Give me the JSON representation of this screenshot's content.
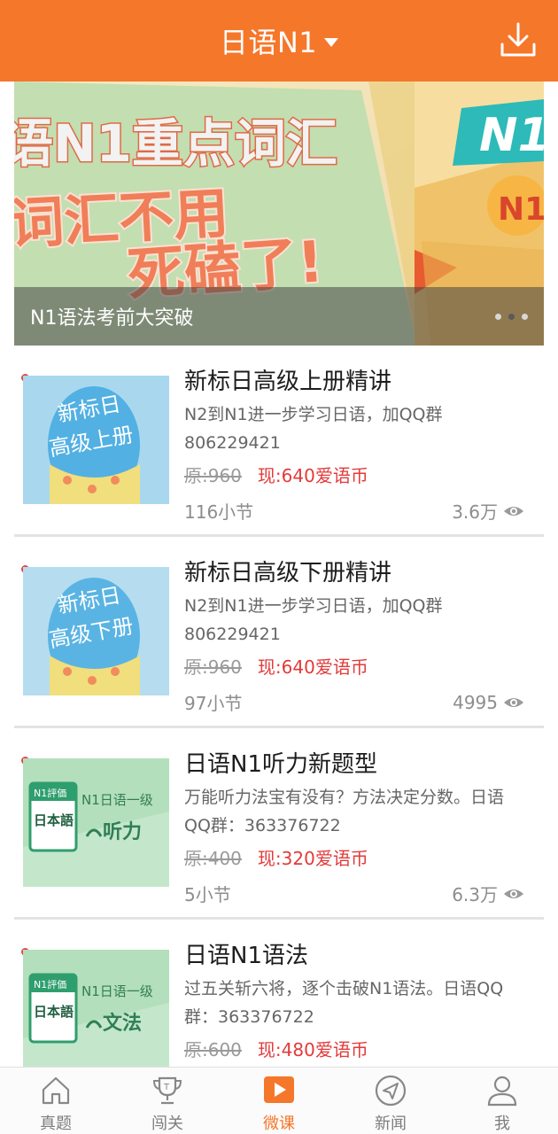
{
  "header": {
    "title": "日语N1",
    "download_icon": "download-icon",
    "bg_color": "#f5772a"
  },
  "banner": {
    "caption": "N1语法考前大突破",
    "art_line1": "语N1重点词汇",
    "art_line2": "词汇不用",
    "art_line3": "死磕了!",
    "art_side_top": "N1",
    "art_side_badge": "N1",
    "active_dot": 2,
    "dot_count": 3
  },
  "courses": [
    {
      "title": "新标日高级上册精讲",
      "desc": "N2到N1进一步学习日语，加QQ群806229421",
      "price_old": "原:960",
      "price_now": "现:640爱语币",
      "lessons": "116小节",
      "views": "3.6万",
      "thumb_line1": "新标日",
      "thumb_line2": "高级上册"
    },
    {
      "title": "新标日高级下册精讲",
      "desc": "N2到N1进一步学习日语，加QQ群806229421",
      "price_old": "原:960",
      "price_now": "现:640爱语币",
      "lessons": "97小节",
      "views": "4995",
      "thumb_line1": "新标日",
      "thumb_line2": "高级下册"
    },
    {
      "title": "日语N1听力新题型",
      "desc": "万能听力法宝有没有？方法决定分数。日语QQ群：363376722",
      "price_old": "原:400",
      "price_now": "现:320爱语币",
      "lessons": "5小节",
      "views": "6.3万",
      "thumb_book_top": "N1評価",
      "thumb_book_main": "日本語",
      "thumb_side_top": "N1日语一级",
      "thumb_side_bottom": "听力"
    },
    {
      "title": "日语N1语法",
      "desc": "过五关斩六将，逐个击破N1语法。日语QQ群：363376722",
      "price_old": "原:600",
      "price_now": "现:480爱语币",
      "lessons": "",
      "views": "",
      "thumb_book_top": "N1評価",
      "thumb_book_main": "日本語",
      "thumb_side_top": "N1日语一级",
      "thumb_side_bottom": "文法"
    }
  ],
  "bottom_nav": [
    {
      "label": "真题",
      "icon": "home-icon",
      "active": false
    },
    {
      "label": "闯关",
      "icon": "trophy-icon",
      "active": false
    },
    {
      "label": "微课",
      "icon": "play-icon",
      "active": true
    },
    {
      "label": "新闻",
      "icon": "send-icon",
      "active": false
    },
    {
      "label": "我",
      "icon": "user-icon",
      "active": false
    }
  ],
  "colors": {
    "accent": "#f5772a",
    "price": "#e33a3a",
    "thumb_blue": "#a7d8ef",
    "thumb_green": "#bfe6c9"
  }
}
